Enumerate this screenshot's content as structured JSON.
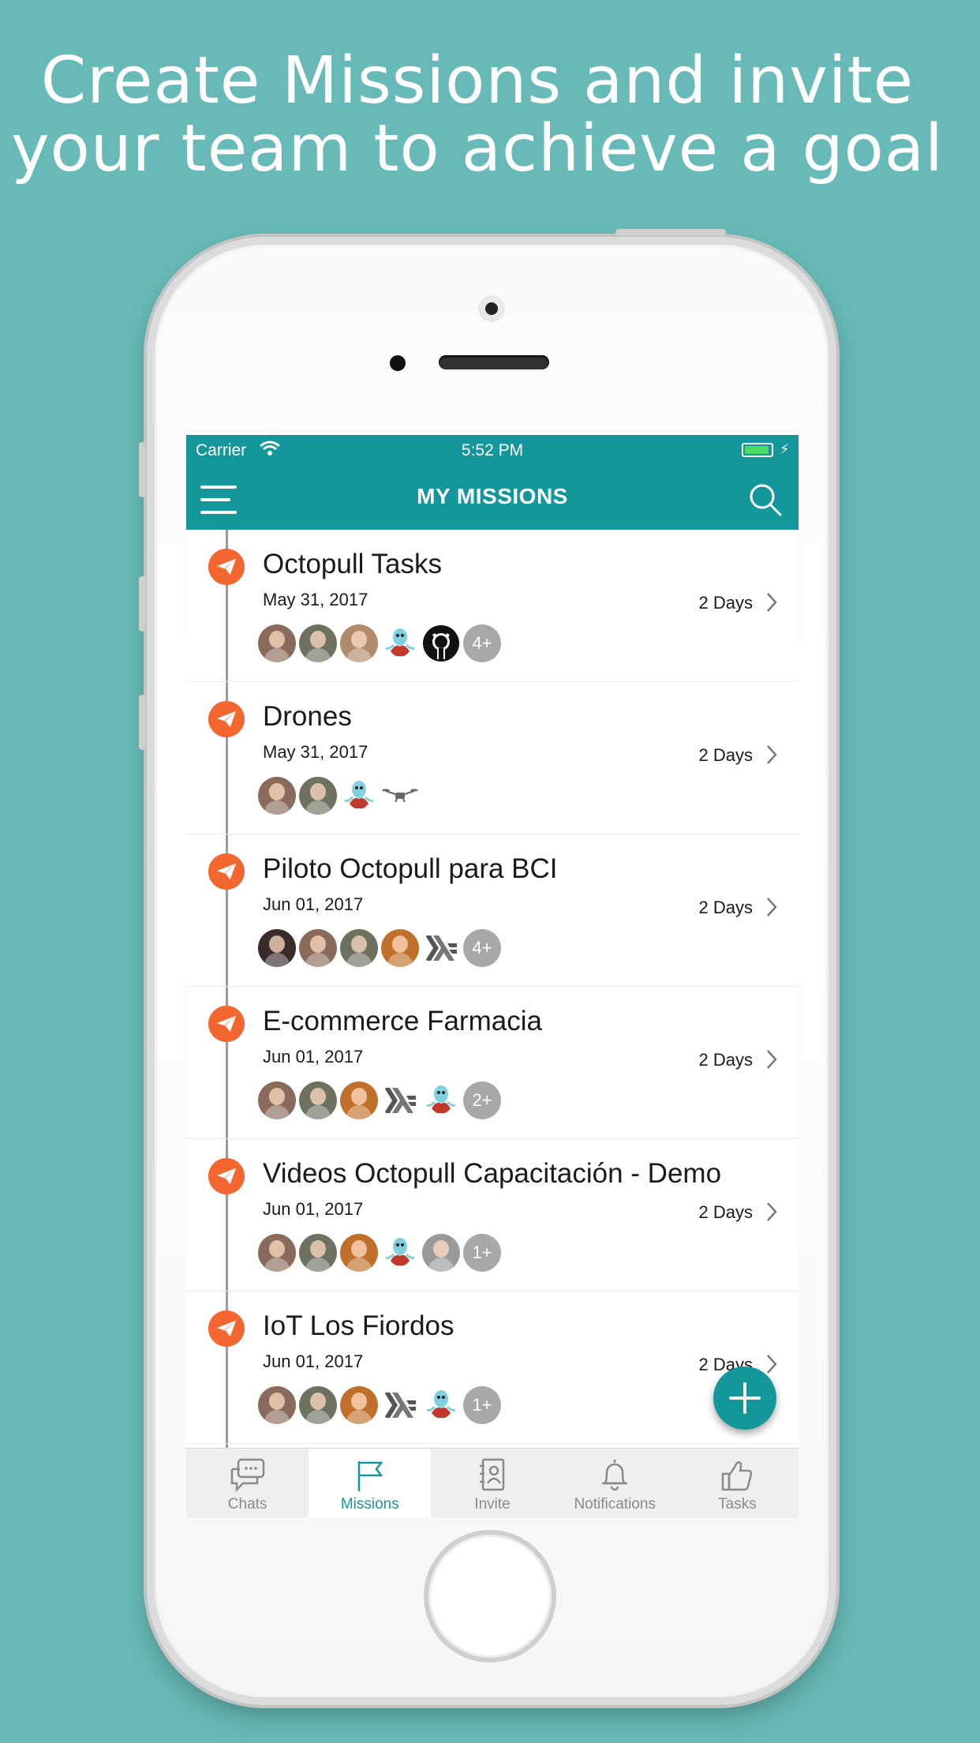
{
  "headline": {
    "line1": "Create Missions and invite",
    "line2": "your team to achieve a goal"
  },
  "colors": {
    "background": "#67bab7",
    "accent": "#14979a",
    "mission_badge": "#f4662f"
  },
  "status_bar": {
    "carrier": "Carrier",
    "time": "5:52 PM"
  },
  "nav": {
    "title": "MY MISSIONS",
    "menu_icon": "hamburger-icon",
    "search_icon": "search-icon"
  },
  "missions": [
    {
      "name": "Octopull Tasks",
      "date": "May 31, 2017",
      "duration": "2 Days",
      "avatars": [
        {
          "kind": "person",
          "color": "#8a6a5a"
        },
        {
          "kind": "person",
          "color": "#6e7060"
        },
        {
          "kind": "person",
          "color": "#b08a6a"
        },
        {
          "kind": "octopus-icon"
        },
        {
          "kind": "github-icon"
        },
        {
          "kind": "more",
          "label": "4+"
        }
      ]
    },
    {
      "name": "Drones",
      "date": "May 31, 2017",
      "duration": "2 Days",
      "avatars": [
        {
          "kind": "person",
          "color": "#8a6a5a"
        },
        {
          "kind": "person",
          "color": "#6e7060"
        },
        {
          "kind": "octopus-icon"
        },
        {
          "kind": "drone-icon"
        }
      ]
    },
    {
      "name": "Piloto Octopull para BCI",
      "date": "Jun 01, 2017",
      "duration": "2 Days",
      "avatars": [
        {
          "kind": "person",
          "color": "#3a2a2a"
        },
        {
          "kind": "person",
          "color": "#8a6a5a"
        },
        {
          "kind": "person",
          "color": "#6e7060"
        },
        {
          "kind": "person",
          "color": "#c0702a"
        },
        {
          "kind": "haskell-icon"
        },
        {
          "kind": "more",
          "label": "4+"
        }
      ]
    },
    {
      "name": "E-commerce Farmacia",
      "date": "Jun 01, 2017",
      "duration": "2 Days",
      "avatars": [
        {
          "kind": "person",
          "color": "#8a6a5a"
        },
        {
          "kind": "person",
          "color": "#6e7060"
        },
        {
          "kind": "person",
          "color": "#c0702a"
        },
        {
          "kind": "haskell-icon"
        },
        {
          "kind": "octopus-icon"
        },
        {
          "kind": "more",
          "label": "2+"
        }
      ]
    },
    {
      "name": "Videos Octopull Capacitación - Demo",
      "date": "Jun 01, 2017",
      "duration": "2 Days",
      "avatars": [
        {
          "kind": "person",
          "color": "#8a6a5a"
        },
        {
          "kind": "person",
          "color": "#6e7060"
        },
        {
          "kind": "person",
          "color": "#c0702a"
        },
        {
          "kind": "octopus-icon"
        },
        {
          "kind": "person",
          "color": "#9a9a9a"
        },
        {
          "kind": "more",
          "label": "1+"
        }
      ]
    },
    {
      "name": "IoT Los Fiordos",
      "date": "Jun 01, 2017",
      "duration": "2 Days",
      "avatars": [
        {
          "kind": "person",
          "color": "#8a6a5a"
        },
        {
          "kind": "person",
          "color": "#6e7060"
        },
        {
          "kind": "person",
          "color": "#c0702a"
        },
        {
          "kind": "haskell-icon"
        },
        {
          "kind": "octopus-icon"
        },
        {
          "kind": "more",
          "label": "1+"
        }
      ]
    }
  ],
  "fab": {
    "icon": "plus-icon"
  },
  "tabs": [
    {
      "label": "Chats",
      "icon": "chat-icon",
      "active": false
    },
    {
      "label": "Missions",
      "icon": "flag-icon",
      "active": true
    },
    {
      "label": "Invite",
      "icon": "contacts-icon",
      "active": false
    },
    {
      "label": "Notifications",
      "icon": "bell-icon",
      "active": false
    },
    {
      "label": "Tasks",
      "icon": "thumbs-up-icon",
      "active": false
    }
  ]
}
